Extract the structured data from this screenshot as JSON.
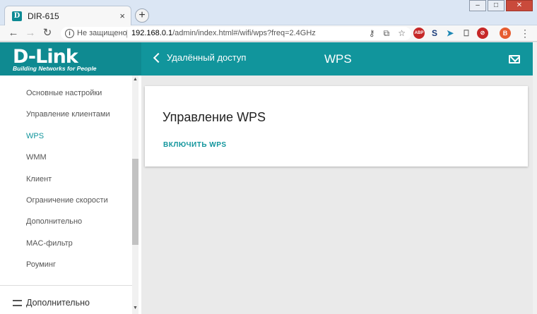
{
  "browser": {
    "tab_title": "DIR-615",
    "tab_favicon_letter": "D",
    "tab_close": "×",
    "new_tab": "+",
    "security_label": "Не защищено",
    "url_host": "192.168.0.1",
    "url_path": "/admin/index.html#/wifi/wps?freq=2.4GHz",
    "profile_initial": "В"
  },
  "header": {
    "brand": "D-Link",
    "brand_tagline": "Building Networks for People",
    "back_label": "Удалённый доступ",
    "page_title": "WPS"
  },
  "sidebar": {
    "items": [
      {
        "label": "Основные настройки"
      },
      {
        "label": "Управление клиентами"
      },
      {
        "label": "WPS"
      },
      {
        "label": "WMM"
      },
      {
        "label": "Клиент"
      },
      {
        "label": "Ограничение скорости"
      },
      {
        "label": "Дополнительно"
      },
      {
        "label": "MAC-фильтр"
      },
      {
        "label": "Роуминг"
      }
    ],
    "active_index": 2,
    "section_label": "Дополнительно"
  },
  "card": {
    "title": "Управление WPS",
    "action_label": "ВКЛЮЧИТЬ WPS"
  },
  "colors": {
    "accent": "#11959c"
  }
}
